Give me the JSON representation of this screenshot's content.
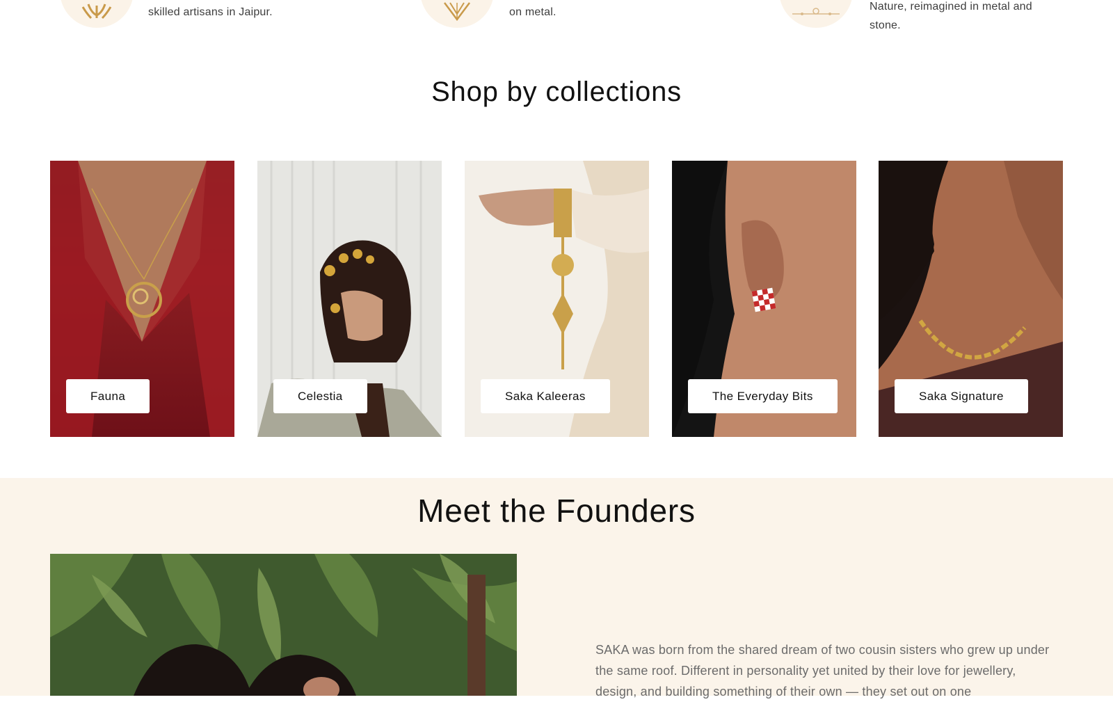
{
  "features": [
    {
      "icon": "artisan-hands-icon",
      "text": "skilled artisans in Jaipur."
    },
    {
      "icon": "lotus-petal-icon",
      "text": "on metal."
    },
    {
      "icon": "ornament-icon",
      "text": "Nature, reimagined in metal and stone."
    }
  ],
  "collections": {
    "title": "Shop by collections",
    "items": [
      {
        "label": "Fauna"
      },
      {
        "label": "Celestia"
      },
      {
        "label": "Saka Kaleeras"
      },
      {
        "label": "The Everyday Bits"
      },
      {
        "label": "Saka Signature"
      }
    ]
  },
  "founders": {
    "title": "Meet the Founders",
    "body": "SAKA was born from the shared dream of two cousin sisters who grew up under the same roof. Different in personality yet united by their love for jewellery, design, and building something of their own — they set out on one"
  },
  "colors": {
    "accent_gold": "#c99a4a",
    "founders_bg": "#fbf4ea",
    "icon_circle_bg": "#fbf3e8"
  }
}
